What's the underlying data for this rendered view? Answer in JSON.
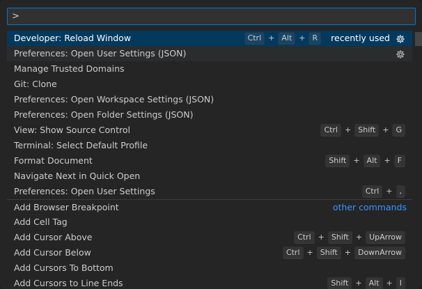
{
  "quick_open": {
    "input_value": ">",
    "items": [
      {
        "label": "Developer: Reload Window",
        "keys": [
          "Ctrl",
          "Alt",
          "R"
        ],
        "tag": "recently used",
        "gear": true,
        "state": "selected"
      },
      {
        "label": "Preferences: Open User Settings (JSON)",
        "keys": [],
        "tag": "",
        "gear": true,
        "state": "hover"
      },
      {
        "label": "Manage Trusted Domains",
        "keys": [],
        "tag": "",
        "gear": false
      },
      {
        "label": "Git: Clone",
        "keys": [],
        "tag": "",
        "gear": false
      },
      {
        "label": "Preferences: Open Workspace Settings (JSON)",
        "keys": [],
        "tag": "",
        "gear": false
      },
      {
        "label": "Preferences: Open Folder Settings (JSON)",
        "keys": [],
        "tag": "",
        "gear": false
      },
      {
        "label": "View: Show Source Control",
        "keys": [
          "Ctrl",
          "Shift",
          "G"
        ],
        "tag": "",
        "gear": false
      },
      {
        "label": "Terminal: Select Default Profile",
        "keys": [],
        "tag": "",
        "gear": false
      },
      {
        "label": "Format Document",
        "keys": [
          "Shift",
          "Alt",
          "F"
        ],
        "tag": "",
        "gear": false
      },
      {
        "label": "Navigate Next in Quick Open",
        "keys": [],
        "tag": "",
        "gear": false
      },
      {
        "label": "Preferences: Open User Settings",
        "keys": [
          "Ctrl",
          ","
        ],
        "tag": "",
        "gear": false
      },
      {
        "label": "Add Browser Breakpoint",
        "keys": [],
        "tag": "",
        "gear": false,
        "separator": true,
        "group_label": "other commands"
      },
      {
        "label": "Add Cell Tag",
        "keys": [],
        "tag": "",
        "gear": false
      },
      {
        "label": "Add Cursor Above",
        "keys": [
          "Ctrl",
          "Shift",
          "UpArrow"
        ],
        "tag": "",
        "gear": false
      },
      {
        "label": "Add Cursor Below",
        "keys": [
          "Ctrl",
          "Shift",
          "DownArrow"
        ],
        "tag": "",
        "gear": false
      },
      {
        "label": "Add Cursors To Bottom",
        "keys": [],
        "tag": "",
        "gear": false
      },
      {
        "label": "Add Cursors to Line Ends",
        "keys": [
          "Shift",
          "Alt",
          "I"
        ],
        "tag": "",
        "gear": false
      }
    ]
  },
  "colors": {
    "accent": "#0078d4",
    "selected_bg": "#04395e",
    "link": "#3794ff"
  },
  "icons": {
    "gear": "gear-icon"
  }
}
